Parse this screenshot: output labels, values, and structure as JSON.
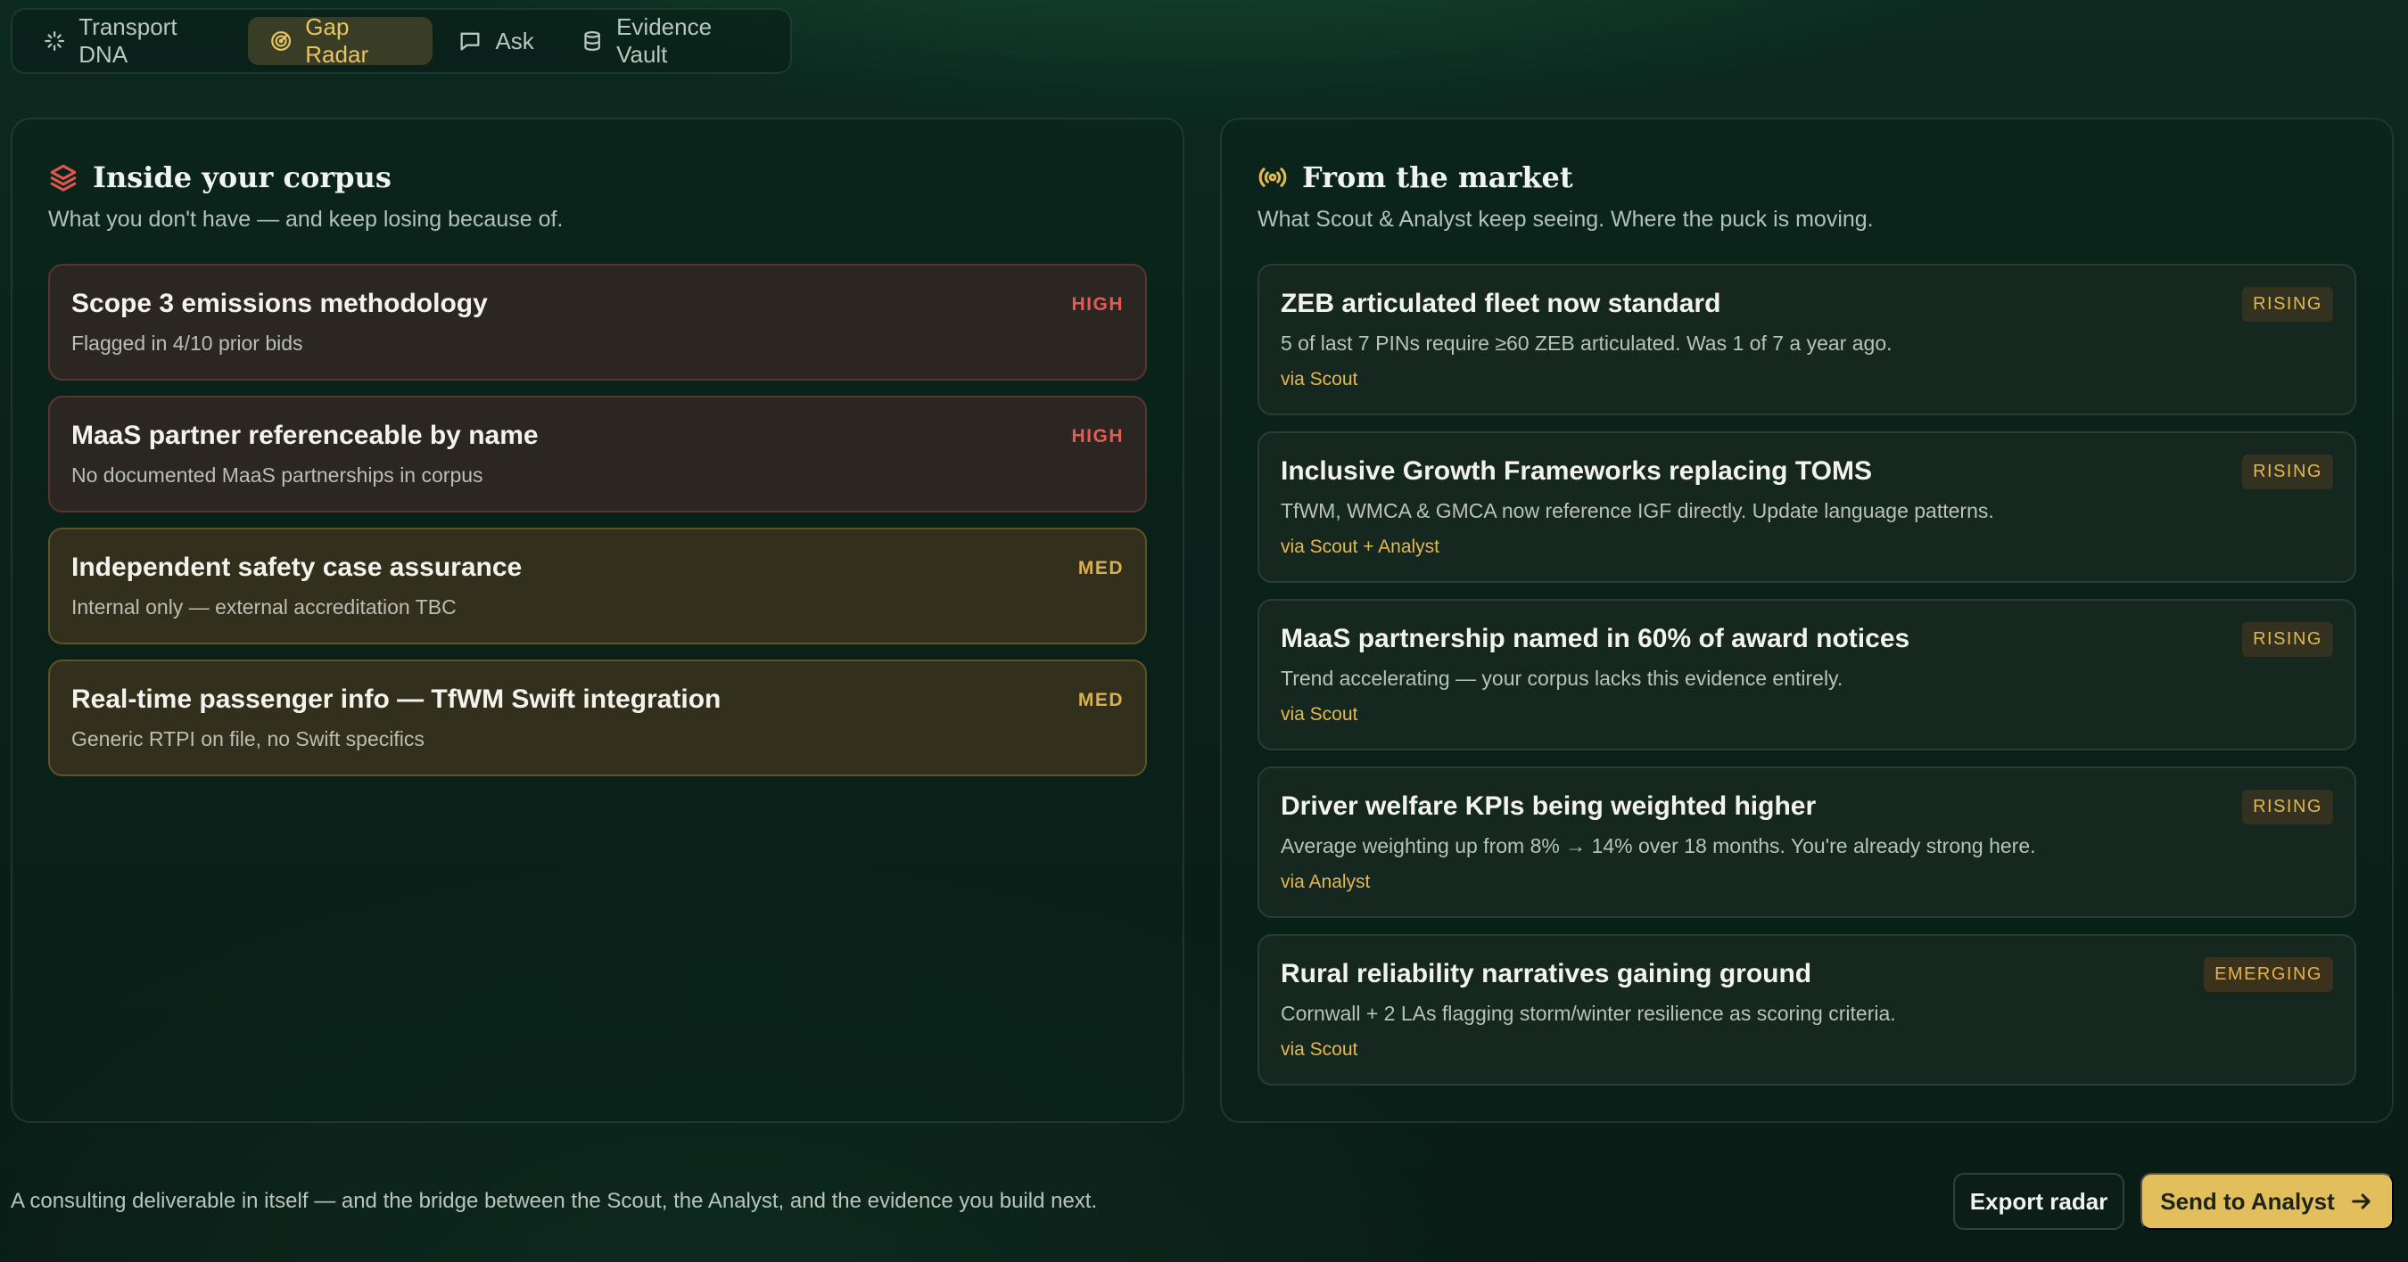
{
  "tabs": [
    {
      "label": "Transport DNA",
      "icon": "sparkle-icon"
    },
    {
      "label": "Gap Radar",
      "icon": "radar-icon",
      "active": true
    },
    {
      "label": "Ask",
      "icon": "chat-bubble-icon"
    },
    {
      "label": "Evidence Vault",
      "icon": "database-icon"
    }
  ],
  "corpus": {
    "title": "Inside your corpus",
    "subtitle": "What you don't have — and keep losing because of.",
    "icon": "layers-icon",
    "icon_color": "#e0564f",
    "gaps": [
      {
        "title": "Scope 3 emissions methodology",
        "detail": "Flagged in 4/10 prior bids",
        "severity": "HIGH"
      },
      {
        "title": "MaaS partner referenceable by name",
        "detail": "No documented MaaS partnerships in corpus",
        "severity": "HIGH"
      },
      {
        "title": "Independent safety case assurance",
        "detail": "Internal only — external accreditation TBC",
        "severity": "MED"
      },
      {
        "title": "Real-time passenger info — TfWM Swift integration",
        "detail": "Generic RTPI on file, no Swift specifics",
        "severity": "MED"
      }
    ]
  },
  "market": {
    "title": "From the market",
    "subtitle": "What Scout & Analyst keep seeing. Where the puck is moving.",
    "icon": "broadcast-icon",
    "icon_color": "#e3b84f",
    "trends": [
      {
        "title": "ZEB articulated fleet now standard",
        "detail": "5 of last 7 PINs require ≥60 ZEB articulated. Was 1 of 7 a year ago.",
        "source": "via Scout",
        "status": "RISING"
      },
      {
        "title": "Inclusive Growth Frameworks replacing TOMS",
        "detail": "TfWM, WMCA & GMCA now reference IGF directly. Update language patterns.",
        "source": "via Scout + Analyst",
        "status": "RISING"
      },
      {
        "title": "MaaS partnership named in 60% of award notices",
        "detail": "Trend accelerating — your corpus lacks this evidence entirely.",
        "source": "via Scout",
        "status": "RISING"
      },
      {
        "title": "Driver welfare KPIs being weighted higher",
        "detail": "Average weighting up from 8% → 14% over 18 months. You're already strong here.",
        "source": "via Analyst",
        "status": "RISING"
      },
      {
        "title": "Rural reliability narratives gaining ground",
        "detail": "Cornwall + 2 LAs flagging storm/winter resilience as scoring criteria.",
        "source": "via Scout",
        "status": "EMERGING"
      }
    ]
  },
  "footer": {
    "note": "A consulting deliverable in itself — and the bridge between the Scout, the Analyst, and the evidence you build next.",
    "export_label": "Export radar",
    "send_label": "Send to Analyst"
  },
  "colors": {
    "accent": "#e2bf5c",
    "high": "#e25c55",
    "med": "#d9b04f",
    "background": "#0b211a"
  }
}
